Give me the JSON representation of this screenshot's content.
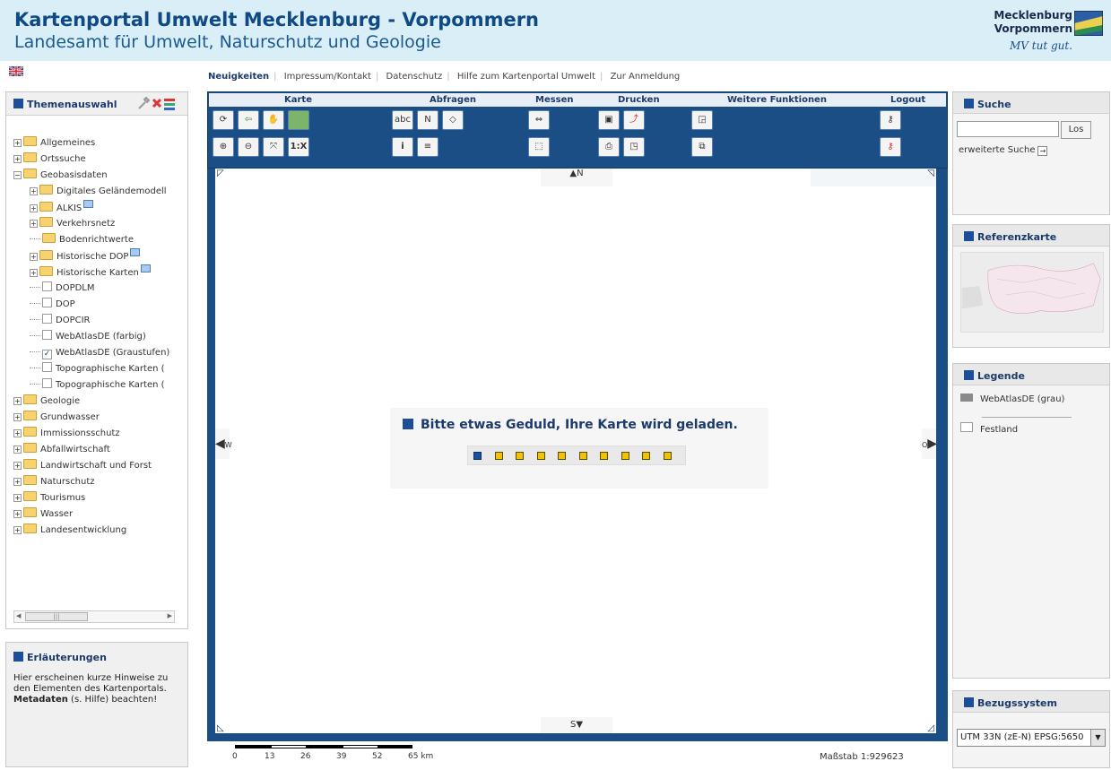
{
  "header": {
    "title": "Kartenportal Umwelt Mecklenburg - Vorpommern",
    "subtitle": "Landesamt für Umwelt, Naturschutz und Geologie",
    "logo_line1": "Mecklenburg",
    "logo_line2": "Vorpommern",
    "logo_slogan": "MV tut gut."
  },
  "topnav": [
    {
      "label": "Neuigkeiten",
      "active": true
    },
    {
      "label": "Impressum/Kontakt"
    },
    {
      "label": "Datenschutz"
    },
    {
      "label": "Hilfe zum Kartenportal Umwelt"
    },
    {
      "label": "Zur Anmeldung"
    }
  ],
  "themes": {
    "title": "Themenauswahl",
    "tree": [
      {
        "label": "Allgemeines",
        "type": "folder",
        "indent": 0,
        "expand": "+"
      },
      {
        "label": "Ortssuche",
        "type": "folder",
        "indent": 0,
        "expand": "+"
      },
      {
        "label": "Geobasisdaten",
        "type": "folder",
        "indent": 0,
        "expand": "-"
      },
      {
        "label": "Digitales Geländemodell",
        "type": "folder",
        "indent": 1,
        "expand": "+"
      },
      {
        "label": "ALKIS",
        "type": "folder",
        "indent": 1,
        "expand": "+",
        "ext": true
      },
      {
        "label": "Verkehrsnetz",
        "type": "folder",
        "indent": 1,
        "expand": "+"
      },
      {
        "label": "Bodenrichtwerte",
        "type": "folder",
        "indent": 1,
        "expand": ""
      },
      {
        "label": "Historische DOP",
        "type": "folder",
        "indent": 1,
        "expand": "+",
        "ext": true
      },
      {
        "label": "Historische Karten",
        "type": "folder",
        "indent": 1,
        "expand": "+",
        "ext": true
      },
      {
        "label": "DOPDLM",
        "type": "check",
        "indent": 1,
        "checked": false
      },
      {
        "label": "DOP",
        "type": "check",
        "indent": 1,
        "checked": false
      },
      {
        "label": "DOPCIR",
        "type": "check",
        "indent": 1,
        "checked": false
      },
      {
        "label": "WebAtlasDE (farbig)",
        "type": "check",
        "indent": 1,
        "checked": false
      },
      {
        "label": "WebAtlasDE (Graustufen)",
        "type": "check",
        "indent": 1,
        "checked": true
      },
      {
        "label": "Topographische Karten (",
        "type": "check",
        "indent": 1,
        "checked": false
      },
      {
        "label": "Topographische Karten (",
        "type": "check",
        "indent": 1,
        "checked": false
      },
      {
        "label": "Geologie",
        "type": "folder",
        "indent": 0,
        "expand": "+"
      },
      {
        "label": "Grundwasser",
        "type": "folder",
        "indent": 0,
        "expand": "+"
      },
      {
        "label": "Immissionsschutz",
        "type": "folder",
        "indent": 0,
        "expand": "+"
      },
      {
        "label": "Abfallwirtschaft",
        "type": "folder",
        "indent": 0,
        "expand": "+"
      },
      {
        "label": "Landwirtschaft und Forst",
        "type": "folder",
        "indent": 0,
        "expand": "+"
      },
      {
        "label": "Naturschutz",
        "type": "folder",
        "indent": 0,
        "expand": "+"
      },
      {
        "label": "Tourismus",
        "type": "folder",
        "indent": 0,
        "expand": "+"
      },
      {
        "label": "Wasser",
        "type": "folder",
        "indent": 0,
        "expand": "+"
      },
      {
        "label": "Landesentwicklung",
        "type": "folder",
        "indent": 0,
        "expand": "+"
      }
    ]
  },
  "erlaeuterungen": {
    "title": "Erläuterungen",
    "text": "Hier erscheinen kurze Hinweise zu den Elementen des Kartenportals.",
    "meta_bold": "Metadaten",
    "meta_rest": " (s. Hilfe) beachten!"
  },
  "toolbar": {
    "groups": [
      "Karte",
      "Abfragen",
      "Messen",
      "Drucken",
      "Weitere Funktionen",
      "Logout"
    ],
    "scale_btn": "1:X"
  },
  "map": {
    "loading_text": "Bitte etwas Geduld, Ihre Karte wird geladen.",
    "loading_dots": 10,
    "loading_progress": 1,
    "north": "N",
    "south": "S",
    "west": "W",
    "east": "O"
  },
  "scalebar": {
    "ticks": [
      "0",
      "13",
      "26",
      "39",
      "52",
      "65 km"
    ],
    "massstab": "Maßstab 1:929623"
  },
  "suche": {
    "title": "Suche",
    "button": "Los",
    "advanced": "erweiterte Suche"
  },
  "referenzkarte": {
    "title": "Referenzkarte"
  },
  "legende": {
    "title": "Legende",
    "items": [
      {
        "label": "WebAtlasDE (grau)",
        "swatch": "#8a8a8a"
      },
      {
        "label": "Festland",
        "swatch": "#ffffff"
      }
    ]
  },
  "bezugssystem": {
    "title": "Bezugssystem",
    "selected": "UTM 33N (zE-N) EPSG:5650"
  },
  "colors": {
    "header_bg": "#d9eef6",
    "brand_blue": "#1a4e84",
    "accent_square": "#1c4f9a",
    "dot_yellow": "#f0c200"
  }
}
